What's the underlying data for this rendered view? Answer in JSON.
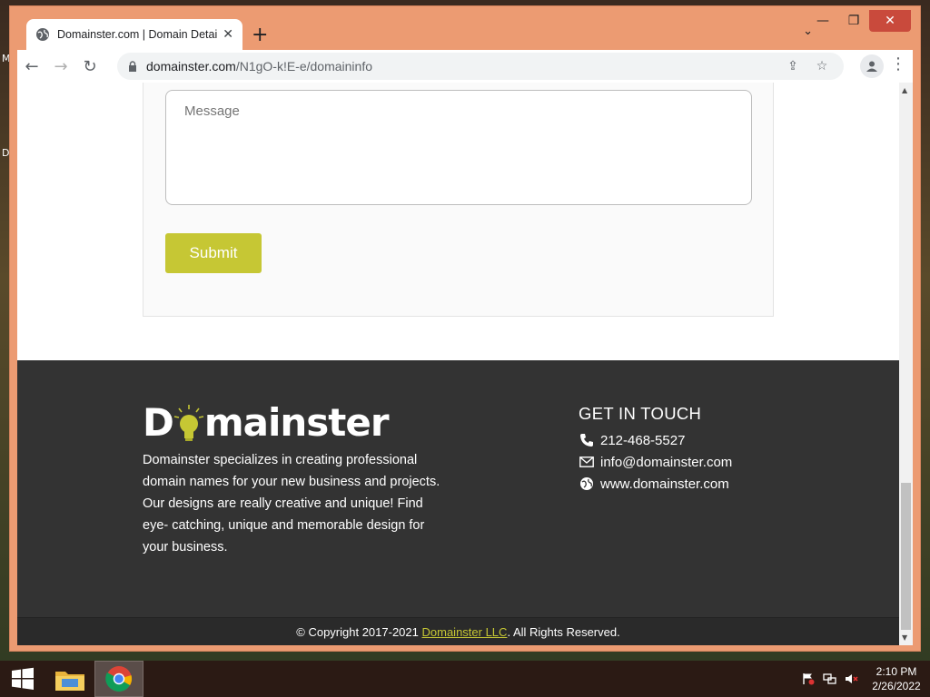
{
  "desktop": {
    "left_letters": [
      "M",
      "D"
    ]
  },
  "browser": {
    "tab_title": "Domainster.com | Domain Details",
    "tab_close": "✕",
    "new_tab": "+",
    "window_controls": {
      "minimize": "—",
      "maximize": "❐",
      "close": "✕"
    },
    "url_host": "domainster.com",
    "url_path": "/N1gO-k!E-e/domaininfo"
  },
  "form": {
    "message_placeholder": "Message",
    "submit_label": "Submit"
  },
  "footer": {
    "logo_text_left": "D",
    "logo_text_right": "mainster",
    "about": "Domainster specializes in creating professional domain names for your new business and projects. Our designs are really creative and unique! Find eye- catching, unique and memorable design for your business.",
    "contact_heading": "GET IN TOUCH",
    "phone": "212-468-5527",
    "email": "info@domainster.com",
    "website": "www.domainster.com",
    "copyright_prefix": "© Copyright 2017-2021 ",
    "copyright_link": "Domainster LLC",
    "copyright_suffix": ". All Rights Reserved."
  },
  "taskbar": {
    "time": "2:10 PM",
    "date": "2/26/2022"
  },
  "colors": {
    "accent": "#c6c734",
    "footer_bg": "#333333",
    "window_frame": "#ec9b72"
  }
}
